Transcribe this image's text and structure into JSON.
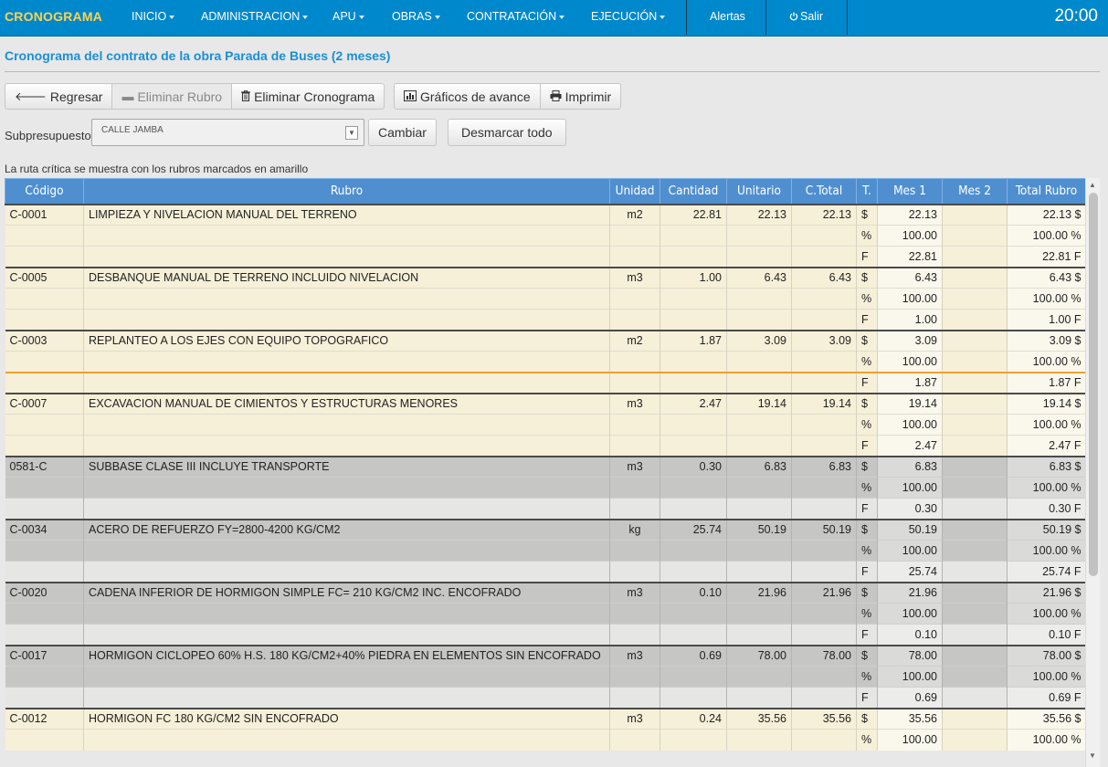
{
  "nav": {
    "brand": "CRONOGRAMA",
    "menu": [
      "INICIO",
      "ADMINISTRACION",
      "APU",
      "OBRAS",
      "CONTRATACIÓN",
      "EJECUCIÓN"
    ],
    "alerts": "Alertas",
    "logout": "Salir",
    "clock": "20:00"
  },
  "page": {
    "title": "Cronograma del contrato de la obra Parada de Buses (2 meses)"
  },
  "toolbar": {
    "back": "Regresar",
    "remove_item": "Eliminar Rubro",
    "remove_schedule": "Eliminar Cronograma",
    "charts": "Gráficos de avance",
    "print": "Imprimir"
  },
  "subbudget": {
    "label": "Subpresupuesto:",
    "selected": "CALLE JAMBA",
    "change": "Cambiar",
    "unmark": "Desmarcar todo"
  },
  "note": "La ruta crítica se muestra con los rubros marcados en amarillo",
  "table": {
    "headers": [
      "Código",
      "Rubro",
      "Unidad",
      "Cantidad",
      "Unitario",
      "C.Total",
      "T.",
      "Mes 1",
      "Mes 2",
      "Total Rubro"
    ],
    "rows": [
      {
        "code": "C-0001",
        "name": "LIMPIEZA Y NIVELACION MANUAL DEL TERRENO",
        "unit": "m2",
        "qty": "22.81",
        "unit_price": "22.13",
        "total": "22.13",
        "m1_money": "22.13",
        "tot_money": "22.13 $",
        "m1_pct": "100.00",
        "tot_pct": "100.00 %",
        "m1_phys": "22.81",
        "tot_phys": "22.81 F",
        "highlight": "yellow"
      },
      {
        "code": "C-0005",
        "name": "DESBANQUE MANUAL DE TERRENO INCLUIDO NIVELACION",
        "unit": "m3",
        "qty": "1.00",
        "unit_price": "6.43",
        "total": "6.43",
        "m1_money": "6.43",
        "tot_money": "6.43 $",
        "m1_pct": "100.00",
        "tot_pct": "100.00 %",
        "m1_phys": "1.00",
        "tot_phys": "1.00 F",
        "highlight": "yellow"
      },
      {
        "code": "C-0003",
        "name": "REPLANTEO A LOS EJES CON EQUIPO TOPOGRAFICO",
        "unit": "m2",
        "qty": "1.87",
        "unit_price": "3.09",
        "total": "3.09",
        "m1_money": "3.09",
        "tot_money": "3.09 $",
        "m1_pct": "100.00",
        "tot_pct": "100.00 %",
        "m1_phys": "1.87",
        "tot_phys": "1.87 F",
        "highlight": "yellow"
      },
      {
        "code": "C-0007",
        "name": "EXCAVACION MANUAL DE CIMIENTOS Y ESTRUCTURAS MENORES",
        "unit": "m3",
        "qty": "2.47",
        "unit_price": "19.14",
        "total": "19.14",
        "m1_money": "19.14",
        "tot_money": "19.14 $",
        "m1_pct": "100.00",
        "tot_pct": "100.00 %",
        "m1_phys": "2.47",
        "tot_phys": "2.47 F",
        "highlight": "yellow"
      },
      {
        "code": "0581-C",
        "name": "SUBBASE CLASE III INCLUYE TRANSPORTE",
        "unit": "m3",
        "qty": "0.30",
        "unit_price": "6.83",
        "total": "6.83",
        "m1_money": "6.83",
        "tot_money": "6.83 $",
        "m1_pct": "100.00",
        "tot_pct": "100.00 %",
        "m1_phys": "0.30",
        "tot_phys": "0.30 F",
        "highlight": "gray"
      },
      {
        "code": "C-0034",
        "name": "ACERO DE REFUERZO FY=2800-4200 KG/CM2",
        "unit": "kg",
        "qty": "25.74",
        "unit_price": "50.19",
        "total": "50.19",
        "m1_money": "50.19",
        "tot_money": "50.19 $",
        "m1_pct": "100.00",
        "tot_pct": "100.00 %",
        "m1_phys": "25.74",
        "tot_phys": "25.74 F",
        "highlight": "gray"
      },
      {
        "code": "C-0020",
        "name": "CADENA INFERIOR DE HORMIGON SIMPLE FC= 210 KG/CM2 INC. ENCOFRADO",
        "unit": "m3",
        "qty": "0.10",
        "unit_price": "21.96",
        "total": "21.96",
        "m1_money": "21.96",
        "tot_money": "21.96 $",
        "m1_pct": "100.00",
        "tot_pct": "100.00 %",
        "m1_phys": "0.10",
        "tot_phys": "0.10 F",
        "highlight": "gray"
      },
      {
        "code": "C-0017",
        "name": "HORMIGON CICLOPEO 60% H.S. 180 KG/CM2+40% PIEDRA EN ELEMENTOS SIN ENCOFRADO",
        "unit": "m3",
        "qty": "0.69",
        "unit_price": "78.00",
        "total": "78.00",
        "m1_money": "78.00",
        "tot_money": "78.00 $",
        "m1_pct": "100.00",
        "tot_pct": "100.00 %",
        "m1_phys": "0.69",
        "tot_phys": "0.69 F",
        "highlight": "gray"
      },
      {
        "code": "C-0012",
        "name": "HORMIGON FC 180 KG/CM2 SIN ENCOFRADO",
        "unit": "m3",
        "qty": "0.24",
        "unit_price": "35.56",
        "total": "35.56",
        "m1_money": "35.56",
        "tot_money": "35.56 $",
        "m1_pct": "100.00",
        "tot_pct": "100.00 %",
        "m1_phys": "",
        "tot_phys": "",
        "highlight": "yellow"
      }
    ],
    "type_labels": {
      "money": "$",
      "pct": "%",
      "phys": "F"
    }
  },
  "colors": {
    "navbar": "#0088cc",
    "brand": "#ffd24d",
    "header": "#4f8fd0",
    "critical_row": "#f6f0d8",
    "normal_row": "#c6c6c4",
    "title": "#1a8fd6"
  }
}
